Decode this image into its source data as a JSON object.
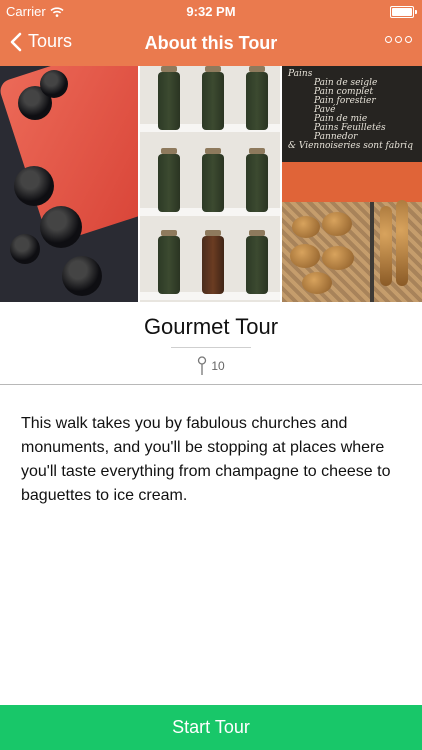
{
  "status_bar": {
    "carrier": "Carrier",
    "time": "9:32 PM"
  },
  "nav": {
    "back_label": "Tours",
    "title": "About this Tour",
    "more_icon": "ellipsis-circles-icon"
  },
  "tour": {
    "name": "Gourmet Tour",
    "stop_count": "10",
    "description": "This walk takes you by fabulous churches and monuments, and you'll be stopping at places where you'll taste everything from champagne to cheese to baguettes to ice cream."
  },
  "chalkboard_lines": [
    "Pains",
    "Pain de seigle",
    "Pain complet",
    "Pain forestier",
    "Pavé",
    "Pain de mie",
    "Pains Feuilletés",
    "Pannedor",
    "& Viennoiseries sont fabriq"
  ],
  "actions": {
    "start_label": "Start Tour"
  },
  "colors": {
    "nav_bg": "#ea7a4e",
    "start_bg": "#18c769"
  }
}
